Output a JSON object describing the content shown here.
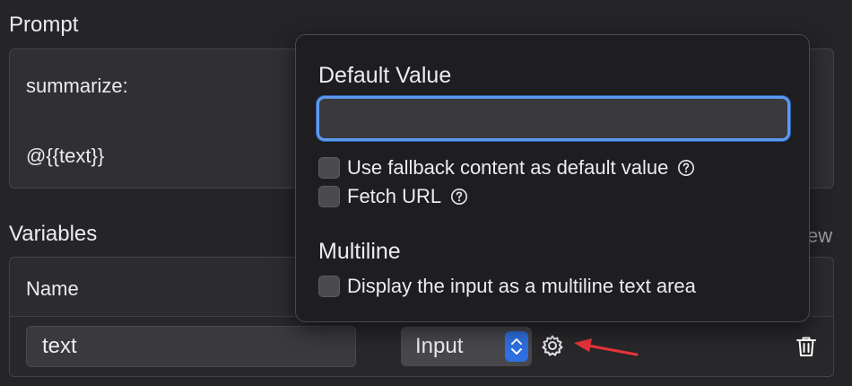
{
  "prompt": {
    "title": "Prompt",
    "lines": [
      "summarize:",
      "@{{text}}"
    ]
  },
  "variables": {
    "title": "Variables",
    "view_label": "ew",
    "columns": {
      "name": "Name"
    },
    "rows": [
      {
        "name": "text",
        "type": "Input"
      }
    ]
  },
  "popover": {
    "default_value_heading": "Default Value",
    "default_value": "",
    "options": [
      {
        "label": "Use fallback content as default value",
        "checked": false,
        "help": true
      },
      {
        "label": "Fetch URL",
        "checked": false,
        "help": true
      }
    ],
    "multiline_heading": "Multiline",
    "multiline_option": {
      "label": "Display the input as a multiline text area",
      "checked": false
    }
  },
  "icons": {
    "gear": "gear-icon",
    "trash": "trash-icon",
    "help": "question-circle-icon",
    "stepper": "chevron-updown-icon",
    "annotation": "red-arrow"
  },
  "colors": {
    "background": "#252427",
    "popover_bg": "#1e1d20",
    "focus_ring": "#5b9af0",
    "accent": "#2f6fe0",
    "annotation_arrow": "#e8343a"
  }
}
